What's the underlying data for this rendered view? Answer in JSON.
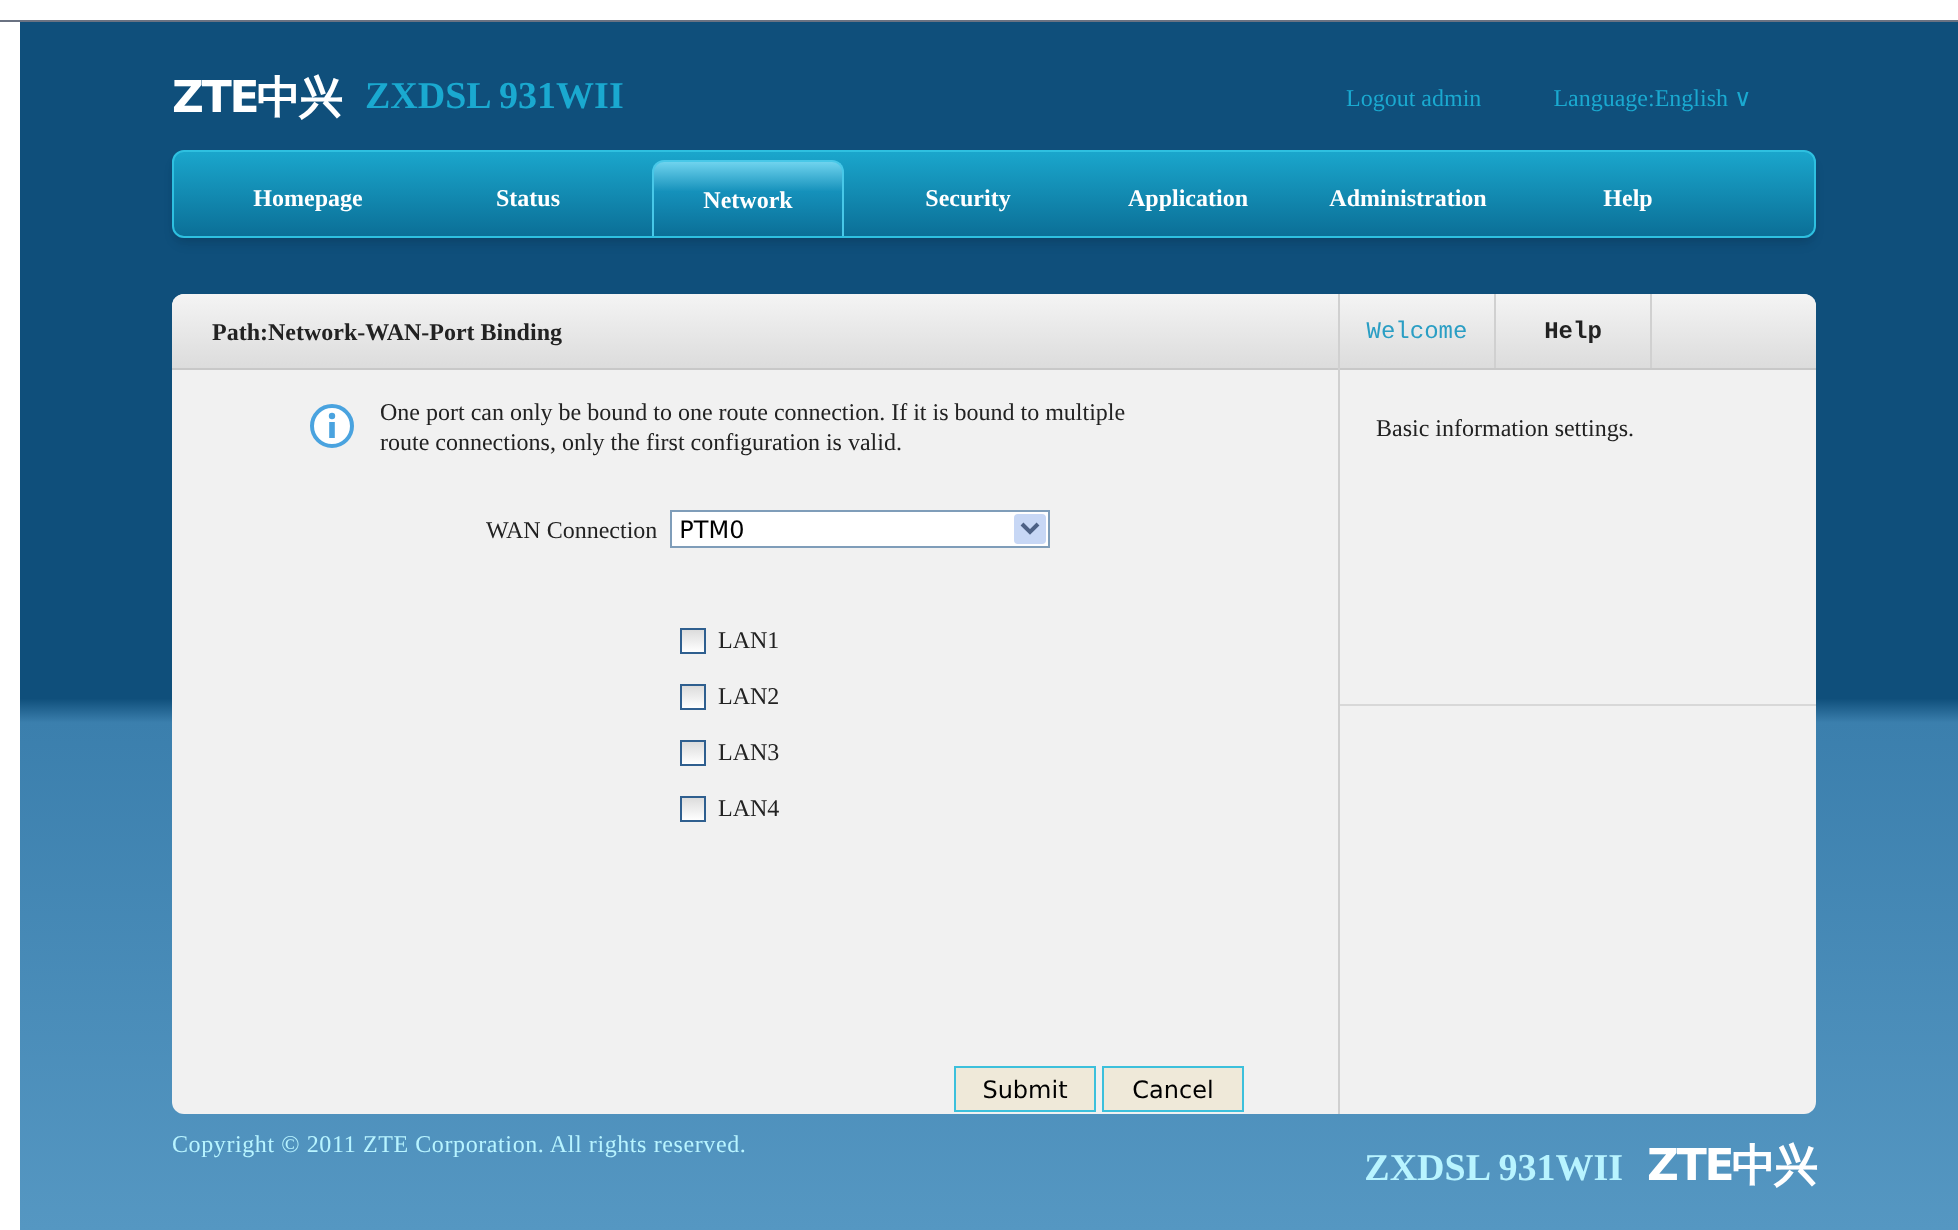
{
  "header": {
    "logo": "ZTE中兴",
    "model": "ZXDSL 931WII",
    "logout": "Logout admin",
    "language": "Language:English ∨"
  },
  "nav": [
    {
      "label": "Homepage",
      "selected": false
    },
    {
      "label": "Status",
      "selected": false
    },
    {
      "label": "Network",
      "selected": true
    },
    {
      "label": "Security",
      "selected": false
    },
    {
      "label": "Application",
      "selected": false
    },
    {
      "label": "Administration",
      "selected": false
    },
    {
      "label": "Help",
      "selected": false
    }
  ],
  "main": {
    "path": "Path:Network-WAN-Port Binding",
    "notice": "One port can only be bound to one route connection. If it is bound to multiple route connections, only the first configuration is valid.",
    "wan_label": "WAN Connection",
    "wan_value": "PTM0",
    "ports": [
      {
        "label": "LAN1",
        "checked": false
      },
      {
        "label": "LAN2",
        "checked": false
      },
      {
        "label": "LAN3",
        "checked": false
      },
      {
        "label": "LAN4",
        "checked": false
      }
    ],
    "buttons": [
      "Submit",
      "Cancel"
    ]
  },
  "side": {
    "tabs": [
      {
        "label": "Welcome",
        "selected": true
      },
      {
        "label": "Help",
        "selected": false
      }
    ],
    "text": "Basic information settings."
  },
  "footer": {
    "copyright": "Copyright © 2011 ZTE Corporation. All rights reserved.",
    "model": "ZXDSL 931WII",
    "logo": "ZTE中兴"
  }
}
